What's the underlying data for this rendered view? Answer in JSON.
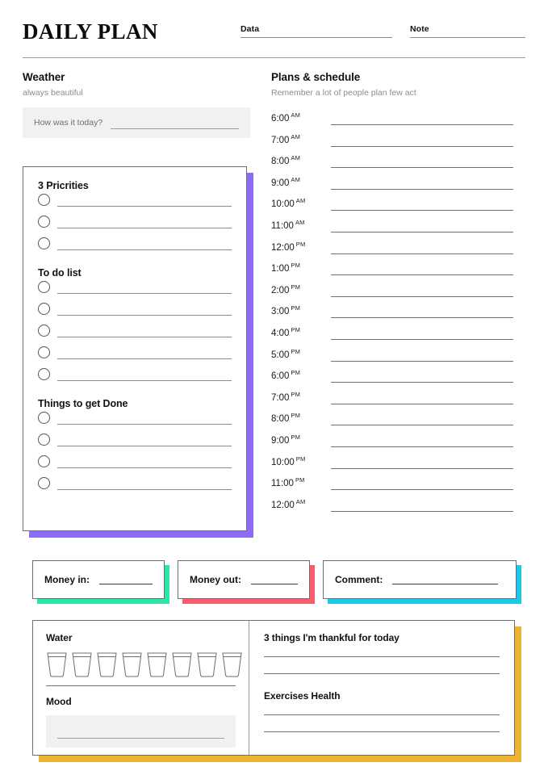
{
  "header": {
    "title": "DAILY PLAN",
    "fields": [
      {
        "label": "Data"
      },
      {
        "label": "Note"
      }
    ]
  },
  "weather": {
    "heading": "Weather",
    "subtitle": "always beautiful",
    "question": "How was it today?"
  },
  "priorities_card": {
    "sections": [
      {
        "heading": "3 Pricrities",
        "items": 3
      },
      {
        "heading": "To do list",
        "items": 5
      },
      {
        "heading": "Things to get Done",
        "items": 4
      }
    ],
    "accent_color": "#8c6bf5"
  },
  "schedule": {
    "heading": "Plans & schedule",
    "subtitle": "Remember a lot of people plan few act",
    "rows": [
      {
        "time": "6:00",
        "meridiem": "AM"
      },
      {
        "time": "7:00",
        "meridiem": "AM"
      },
      {
        "time": "8:00",
        "meridiem": "AM"
      },
      {
        "time": "9:00",
        "meridiem": "AM"
      },
      {
        "time": "10:00",
        "meridiem": "AM"
      },
      {
        "time": "11:00",
        "meridiem": "AM"
      },
      {
        "time": "12:00",
        "meridiem": "PM"
      },
      {
        "time": "1:00",
        "meridiem": "PM"
      },
      {
        "time": "2:00",
        "meridiem": "PM"
      },
      {
        "time": "3:00",
        "meridiem": "PM"
      },
      {
        "time": "4:00",
        "meridiem": "PM"
      },
      {
        "time": "5:00",
        "meridiem": "PM"
      },
      {
        "time": "6:00",
        "meridiem": "PM"
      },
      {
        "time": "7:00",
        "meridiem": "PM"
      },
      {
        "time": "8:00",
        "meridiem": "PM"
      },
      {
        "time": "9:00",
        "meridiem": "PM"
      },
      {
        "time": "10:00",
        "meridiem": "PM"
      },
      {
        "time": "11:00",
        "meridiem": "PM"
      },
      {
        "time": "12:00",
        "meridiem": "AM"
      }
    ]
  },
  "money_row": [
    {
      "label": "Money in:",
      "accent_color": "#2be6a4"
    },
    {
      "label": "Money out:",
      "accent_color": "#fa5e6e"
    },
    {
      "label": "Comment:",
      "accent_color": "#1ec8eb"
    }
  ],
  "bottom_card": {
    "accent_color": "#edb230",
    "water": {
      "heading": "Water",
      "glass_count": 8
    },
    "mood": {
      "heading": "Mood"
    },
    "thankful": {
      "heading": "3 things I'm thankful for today",
      "lines": 2
    },
    "exercises": {
      "heading": "Exercises Health",
      "lines": 2
    }
  }
}
